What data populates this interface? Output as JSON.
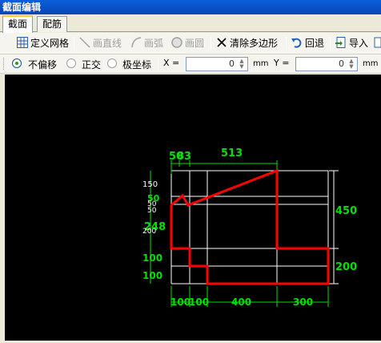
{
  "window": {
    "title": "截面编辑"
  },
  "tabs": [
    {
      "label": "截面",
      "active": true
    },
    {
      "label": "配筋",
      "active": false
    }
  ],
  "toolbar": {
    "define_grid": "定义网格",
    "draw_line": "画直线",
    "draw_arc": "画弧",
    "draw_circle": "画圆",
    "clear_polygon": "清除多边形",
    "undo": "回退",
    "import": "导入"
  },
  "options": {
    "no_offset": "不偏移",
    "orthogonal": "正交",
    "polar": "极坐标",
    "x_label": "X =",
    "x_value": "0",
    "x_unit": "mm",
    "y_label": "Y =",
    "y_value": "0",
    "y_unit": "mm"
  },
  "drawing": {
    "top_dims": [
      "50",
      "83",
      "513"
    ],
    "bottom_dims": [
      "100",
      "100",
      "400",
      "300"
    ],
    "left_dims": [
      "150",
      "50",
      "50",
      "50",
      "248",
      "200",
      "100",
      "100"
    ],
    "right_dims": [
      "450",
      "200"
    ],
    "colors": {
      "dim": "#00e000",
      "grid": "#ffffff",
      "outline": "#ff0000"
    }
  }
}
